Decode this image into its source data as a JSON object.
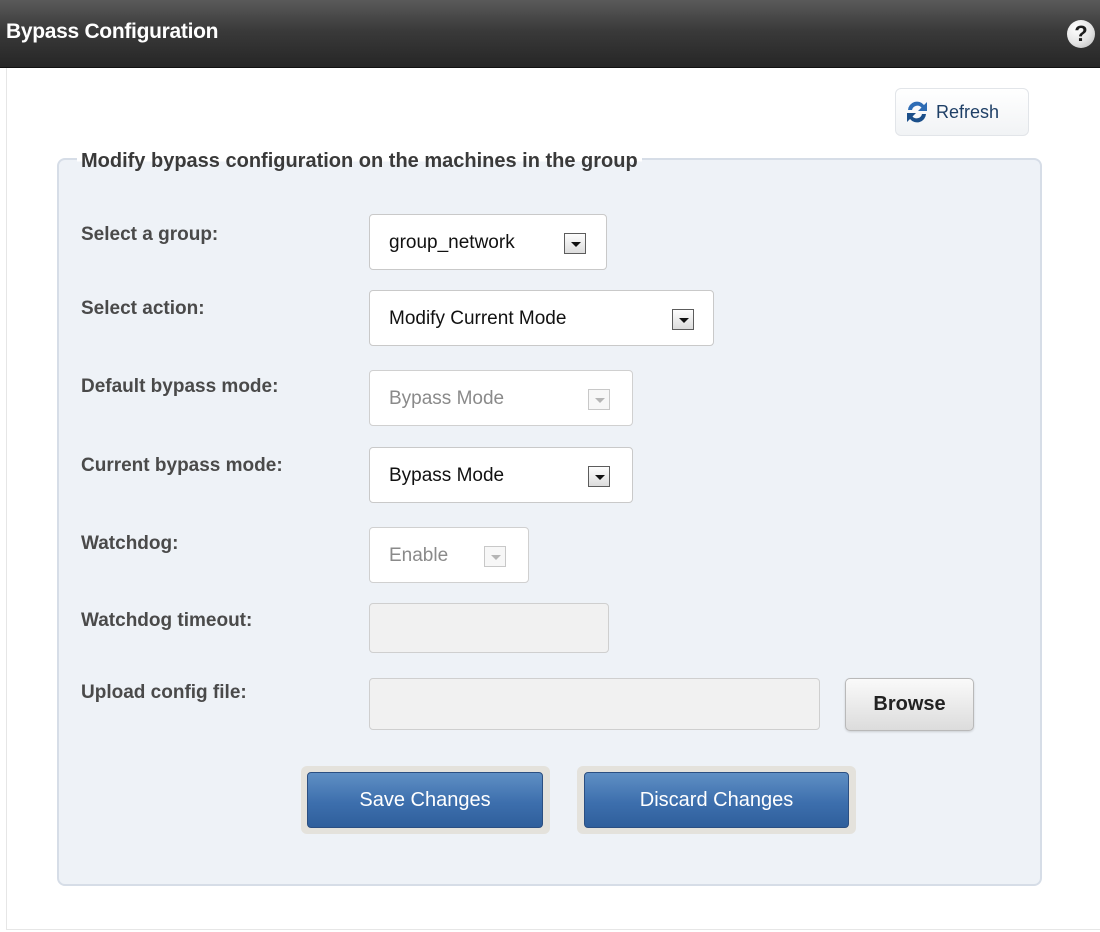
{
  "window": {
    "title": "Bypass Configuration",
    "help_icon": "?"
  },
  "toolbar": {
    "refresh_label": "Refresh",
    "refresh_icon": "refresh-icon"
  },
  "form": {
    "legend": "Modify bypass configuration on the machines in the group",
    "fields": [
      {
        "label": "Select a group:",
        "value": "group_network",
        "enabled": true
      },
      {
        "label": "Select action:",
        "value": "Modify Current Mode",
        "enabled": true
      },
      {
        "label": "Default bypass mode:",
        "value": "Bypass Mode",
        "enabled": false
      },
      {
        "label": "Current bypass mode:",
        "value": "Bypass Mode",
        "enabled": true
      },
      {
        "label": "Watchdog:",
        "value": "Enable",
        "enabled": false
      },
      {
        "label": "Watchdog timeout:",
        "value": "",
        "enabled": false
      },
      {
        "label": "Upload config file:",
        "value": "",
        "enabled": false
      }
    ],
    "browse_label": "Browse",
    "save_label": "Save Changes",
    "discard_label": "Discard Changes"
  },
  "colors": {
    "titlebar": "#333333",
    "fieldset_bg": "#eef2f7",
    "button_blue": "#3d6fad",
    "label_text": "#4a4a4a"
  }
}
